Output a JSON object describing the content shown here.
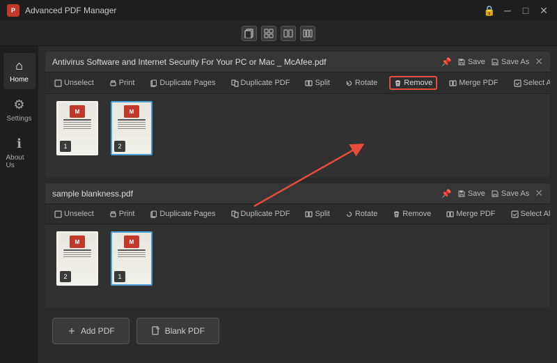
{
  "app": {
    "title": "Advanced PDF Manager",
    "icon_label": "PDF",
    "controls": [
      "🔒",
      "─",
      "□",
      "✕"
    ]
  },
  "toolbar": {
    "buttons": [
      "copy-icon",
      "grid-icon",
      "layout1-icon",
      "layout2-icon"
    ]
  },
  "sidebar": {
    "items": [
      {
        "id": "home",
        "label": "Home",
        "icon": "⌂",
        "active": true
      },
      {
        "id": "settings",
        "label": "Settings",
        "icon": "⚙",
        "active": false
      },
      {
        "id": "about",
        "label": "About Us",
        "icon": "ℹ",
        "active": false
      }
    ]
  },
  "pdf1": {
    "title": "Antivirus Software and Internet Security For Your PC or Mac _ McAfee.pdf",
    "pin_icon": "📌",
    "save_label": "Save",
    "save_as_label": "Save As",
    "toolbar": {
      "unselect": "Unselect",
      "print": "Print",
      "duplicate_pages": "Duplicate Pages",
      "duplicate_pdf": "Duplicate PDF",
      "split": "Split",
      "rotate": "Rotate",
      "remove": "Remove",
      "merge_pdf": "Merge PDF",
      "select_all": "Select All"
    },
    "pages": [
      {
        "number": "1",
        "selected": false
      },
      {
        "number": "2",
        "selected": true
      }
    ]
  },
  "pdf2": {
    "title": "sample blankness.pdf",
    "pin_icon": "📌",
    "save_label": "Save",
    "save_as_label": "Save As",
    "toolbar": {
      "unselect": "Unselect",
      "print": "Print",
      "duplicate_pages": "Duplicate Pages",
      "duplicate_pdf": "Duplicate PDF",
      "split": "Split",
      "rotate": "Rotate",
      "remove": "Remove",
      "merge_pdf": "Merge PDF",
      "select_all": "Select All"
    },
    "pages": [
      {
        "number": "2",
        "selected": false
      },
      {
        "number": "1",
        "selected": true
      }
    ]
  },
  "bottom": {
    "add_pdf": "Add PDF",
    "blank_pdf": "Blank PDF"
  },
  "colors": {
    "accent": "#4a9fd4",
    "remove_border": "#e74c3c",
    "active_thumb": "#4a9fd4"
  }
}
